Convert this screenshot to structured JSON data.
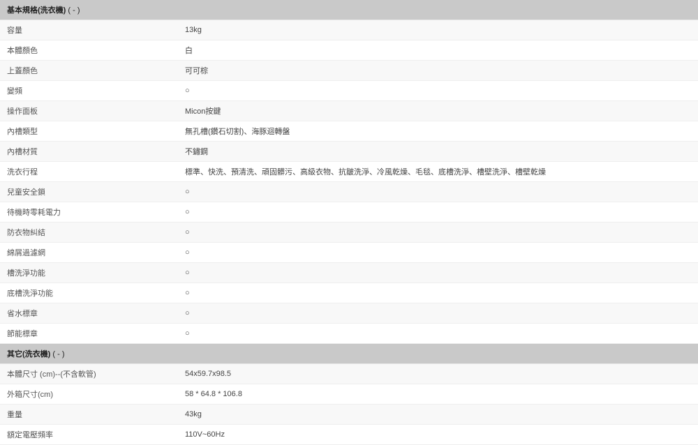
{
  "sections": [
    {
      "title": "基本規格(洗衣機)",
      "collapse": "( - )",
      "rows": [
        {
          "label": "容量",
          "value": "13kg"
        },
        {
          "label": "本體顏色",
          "value": "白"
        },
        {
          "label": "上蓋顏色",
          "value": "可可棕"
        },
        {
          "label": "變頻",
          "value": "○"
        },
        {
          "label": "操作面板",
          "value": "Micon按鍵"
        },
        {
          "label": "內槽類型",
          "value": "無孔槽(鑽石切割)、海豚迴轉盤"
        },
        {
          "label": "內槽材質",
          "value": "不鏽鋼"
        },
        {
          "label": "洗衣行程",
          "value": "標準、快洗、預清洗、頑固髒污、高級衣物、抗皺洗淨、冷風乾燥、毛毯、底槽洗淨、槽壁洗淨、槽壁乾燥"
        },
        {
          "label": "兒童安全鎖",
          "value": "○"
        },
        {
          "label": "待機時零耗電力",
          "value": "○"
        },
        {
          "label": "防衣物糾結",
          "value": "○"
        },
        {
          "label": "綿屑過濾網",
          "value": "○"
        },
        {
          "label": "槽洗淨功能",
          "value": "○"
        },
        {
          "label": "底槽洗淨功能",
          "value": "○"
        },
        {
          "label": "省水標章",
          "value": "○"
        },
        {
          "label": "節能標章",
          "value": "○"
        }
      ]
    },
    {
      "title": "其它(洗衣機)",
      "collapse": "( - )",
      "rows": [
        {
          "label": "本體尺寸 (cm)--(不含軟管)",
          "value": "54x59.7x98.5"
        },
        {
          "label": "外箱尺寸(cm)",
          "value": "58 * 64.8 * 106.8"
        },
        {
          "label": "重量",
          "value": "43kg"
        },
        {
          "label": "額定電壓頻率",
          "value": "110V~60Hz"
        }
      ]
    }
  ]
}
